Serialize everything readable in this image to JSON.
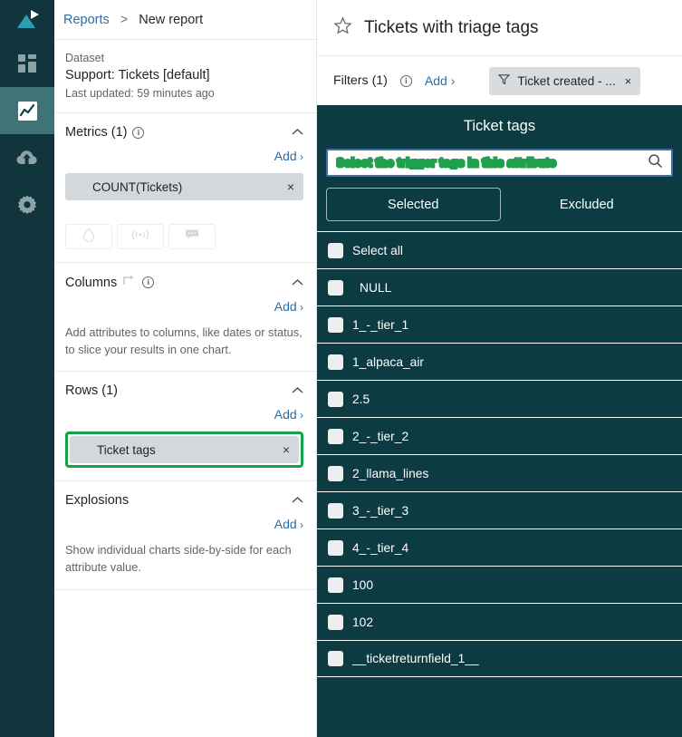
{
  "rail": {
    "logo_name": "app-logo",
    "items": [
      {
        "name": "sidebar-item-dashboards",
        "icon": "grid-icon",
        "active": false
      },
      {
        "name": "sidebar-item-reports",
        "icon": "line-chart-icon",
        "active": true
      },
      {
        "name": "sidebar-item-upload",
        "icon": "cloud-upload-icon",
        "active": false
      },
      {
        "name": "sidebar-item-settings",
        "icon": "gear-icon",
        "active": false
      }
    ]
  },
  "breadcrumb": {
    "root": "Reports",
    "separator": ">",
    "current": "New report"
  },
  "dataset": {
    "label": "Dataset",
    "name": "Support: Tickets [default]",
    "updated": "Last updated: 59 minutes ago"
  },
  "metrics": {
    "title": "Metrics (1)",
    "add_label": "Add",
    "chip": "COUNT(Tickets)",
    "remove_label": "×",
    "buttons": [
      {
        "name": "drop-icon-button",
        "icon": "water-drop-icon"
      },
      {
        "name": "signal-icon-button",
        "icon": "broadcast-signal-icon"
      },
      {
        "name": "comment-icon-button",
        "icon": "comment-bubble-icon"
      }
    ]
  },
  "columns": {
    "title": "Columns",
    "add_label": "Add",
    "description": "Add attributes to columns, like dates or status, to slice your results in one chart."
  },
  "rows": {
    "title": "Rows (1)",
    "add_label": "Add",
    "chip": "Ticket tags",
    "remove_label": "×",
    "highlight_color": "#16a34a"
  },
  "explosions": {
    "title": "Explosions",
    "add_label": "Add",
    "description": "Show individual charts side-by-side for each attribute value."
  },
  "report": {
    "title": "Tickets with triage tags",
    "star_icon": "star-outline-icon"
  },
  "filters": {
    "label": "Filters (1)",
    "add_label": "Add",
    "chip": "Ticket created - ...",
    "chip_icon": "funnel-icon",
    "remove_label": "×"
  },
  "modal": {
    "title": "Ticket tags",
    "search_value": "Select the trigger tags in this attribute",
    "search_icon": "search-icon",
    "search_highlight_color": "#22a14e",
    "tabs": [
      {
        "label": "Selected",
        "active": true
      },
      {
        "label": "Excluded",
        "active": false
      }
    ],
    "options": [
      {
        "label": "Select all",
        "indent": false
      },
      {
        "label": "NULL",
        "indent": true
      },
      {
        "label": "1_-_tier_1",
        "indent": false
      },
      {
        "label": "1_alpaca_air",
        "indent": false
      },
      {
        "label": "2.5",
        "indent": false
      },
      {
        "label": "2_-_tier_2",
        "indent": false
      },
      {
        "label": "2_llama_lines",
        "indent": false
      },
      {
        "label": "3_-_tier_3",
        "indent": false
      },
      {
        "label": "4_-_tier_4",
        "indent": false
      },
      {
        "label": "100",
        "indent": false
      },
      {
        "label": "102",
        "indent": false
      },
      {
        "label": "__ticketreturnfield_1__",
        "indent": false
      }
    ]
  }
}
